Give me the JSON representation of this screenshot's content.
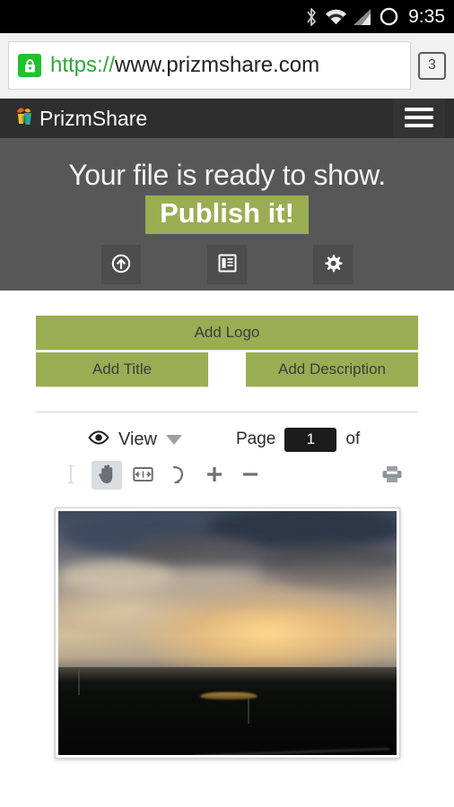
{
  "status_bar": {
    "time": "9:35",
    "icons": [
      "bluetooth-icon",
      "wifi-icon",
      "cell-signal-icon",
      "circle-icon"
    ]
  },
  "browser": {
    "lock_icon": "lock-icon",
    "url_scheme": "https://",
    "url_host": "www.prizmshare.com",
    "tab_count": "3"
  },
  "site_nav": {
    "logo_icon": "prizmshare-logo-icon",
    "brand": "PrizmShare",
    "menu_icon": "hamburger-menu-icon"
  },
  "hero": {
    "headline": "Your file is ready to show.",
    "cta": "Publish it!",
    "highlight_color": "#9bad52",
    "actions": [
      {
        "name": "upload-button",
        "icon": "upload-circle-icon"
      },
      {
        "name": "pages-button",
        "icon": "list-document-icon"
      },
      {
        "name": "settings-button",
        "icon": "gear-icon"
      }
    ]
  },
  "meta_buttons": {
    "add_logo": "Add Logo",
    "add_title": "Add Title",
    "add_description": "Add Description",
    "button_color": "#9bad52"
  },
  "viewer": {
    "view_icon": "eye-icon",
    "view_label": "View",
    "dropdown_icon": "chevron-down-icon",
    "page_label": "Page",
    "page_value": "1",
    "page_of": "of",
    "tools": [
      {
        "name": "text-select-tool",
        "icon": "i-beam-icon",
        "state": "disabled"
      },
      {
        "name": "pan-tool",
        "icon": "hand-icon",
        "state": "active"
      },
      {
        "name": "fit-width-tool",
        "icon": "fit-width-icon",
        "state": "normal"
      },
      {
        "name": "rotate-tool",
        "icon": "rotate-icon",
        "state": "normal"
      },
      {
        "name": "zoom-in-tool",
        "icon": "plus-icon",
        "state": "normal"
      },
      {
        "name": "zoom-out-tool",
        "icon": "minus-icon",
        "state": "normal"
      },
      {
        "name": "print-tool",
        "icon": "printer-icon",
        "state": "normal"
      }
    ]
  },
  "document": {
    "page_content": "sunset-landscape-photo"
  }
}
